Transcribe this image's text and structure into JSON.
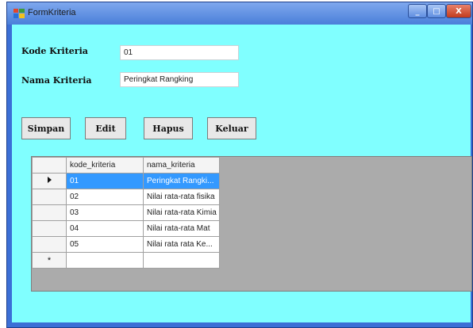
{
  "window": {
    "title": "FormKriteria",
    "controls": {
      "minimize": "_",
      "maximize": "□",
      "close": "X"
    }
  },
  "form": {
    "kode_label": "Kode Kriteria",
    "kode_value": "01",
    "nama_label": "Nama Kriteria",
    "nama_value": "Peringkat Rangking"
  },
  "buttons": {
    "simpan": "Simpan",
    "edit": "Edit",
    "hapus": "Hapus",
    "keluar": "Keluar"
  },
  "grid": {
    "columns": [
      "kode_kriteria",
      "nama_kriteria"
    ],
    "rows": [
      {
        "kode": "01",
        "nama": "Peringkat Rangki..."
      },
      {
        "kode": "02",
        "nama": "Nilai rata-rata fisika"
      },
      {
        "kode": "03",
        "nama": "Nilai rata-rata Kimia"
      },
      {
        "kode": "04",
        "nama": "Nilai rata-rata Mat"
      },
      {
        "kode": "05",
        "nama": "Nilai rata rata Ke..."
      }
    ],
    "new_row_marker": "*",
    "selected_row": 0
  },
  "colors": {
    "client_bg": "#80ffff",
    "title_bar": "#4a7fd9",
    "selection": "#3399ff"
  },
  "icons": [
    "app-icon",
    "minimize-icon",
    "maximize-icon",
    "close-icon",
    "row-pointer-icon",
    "new-row-icon"
  ]
}
